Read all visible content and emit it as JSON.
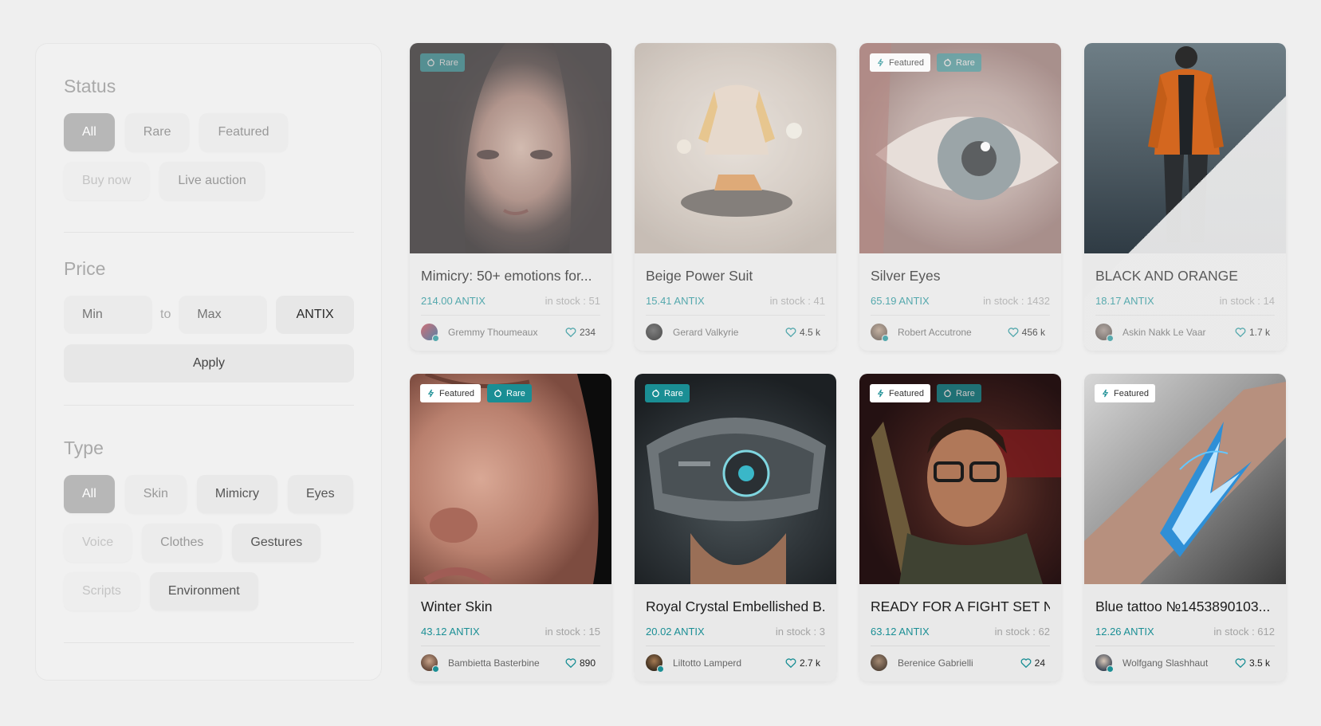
{
  "filters": {
    "status": {
      "title": "Status",
      "options": [
        "All",
        "Rare",
        "Featured",
        "Buy now",
        "Live auction"
      ]
    },
    "price": {
      "title": "Price",
      "min_placeholder": "Min",
      "to_label": "to",
      "max_placeholder": "Max",
      "currency": "ANTIX",
      "apply_label": "Apply"
    },
    "type": {
      "title": "Type",
      "options": [
        "All",
        "Skin",
        "Mimicry",
        "Eyes",
        "Voice",
        "Clothes",
        "Gestures",
        "Scripts",
        "Environment"
      ]
    }
  },
  "badge_labels": {
    "featured": "Featured",
    "rare": "Rare"
  },
  "colors": {
    "accent": "#1b8f95",
    "active_pill": "#b7b7b7"
  },
  "items": [
    {
      "title": "Mimicry: 50+ emotions for...",
      "price": "214.00 ANTIX",
      "stock": "in stock : 51",
      "author": "Gremmy Thoumeaux",
      "likes": "234",
      "badges": {
        "featured": "",
        "rare": "Rare"
      }
    },
    {
      "title": "Beige Power Suit",
      "price": "15.41 ANTIX",
      "stock": "in stock : 41",
      "author": "Gerard Valkyrie",
      "likes": "4.5 k",
      "badges": {
        "featured": "",
        "rare": ""
      }
    },
    {
      "title": "Silver Eyes",
      "price": "65.19 ANTIX",
      "stock": "in stock : 1432",
      "author": "Robert Accutrone",
      "likes": "456 k",
      "badges": {
        "featured": "Featured",
        "rare": "Rare"
      }
    },
    {
      "title": "BLACK AND ORANGE",
      "price": "18.17 ANTIX",
      "stock": "in stock : 14",
      "author": "Askin Nakk Le Vaar",
      "likes": "1.7 k",
      "badges": {
        "featured": "",
        "rare": ""
      }
    },
    {
      "title": "Winter Skin",
      "price": "43.12 ANTIX",
      "stock": "in stock : 15",
      "author": "Bambietta Basterbine",
      "likes": "890",
      "badges": {
        "featured": "Featured",
        "rare": "Rare"
      }
    },
    {
      "title": "Royal Crystal Embellished B...",
      "price": "20.02 ANTIX",
      "stock": "in stock : 3",
      "author": "Liltotto Lamperd",
      "likes": "2.7 k",
      "badges": {
        "featured": "",
        "rare": "Rare"
      }
    },
    {
      "title": "READY FOR A FIGHT SET N...",
      "price": "63.12 ANTIX",
      "stock": "in stock : 62",
      "author": "Berenice Gabrielli",
      "likes": "24",
      "badges": {
        "featured": "Featured",
        "rare": "Rare"
      }
    },
    {
      "title": "Blue tattoo №1453890103...",
      "price": "12.26 ANTIX",
      "stock": "in stock : 612",
      "author": "Wolfgang Slashhaut",
      "likes": "3.5 k",
      "badges": {
        "featured": "Featured",
        "rare": ""
      }
    }
  ]
}
